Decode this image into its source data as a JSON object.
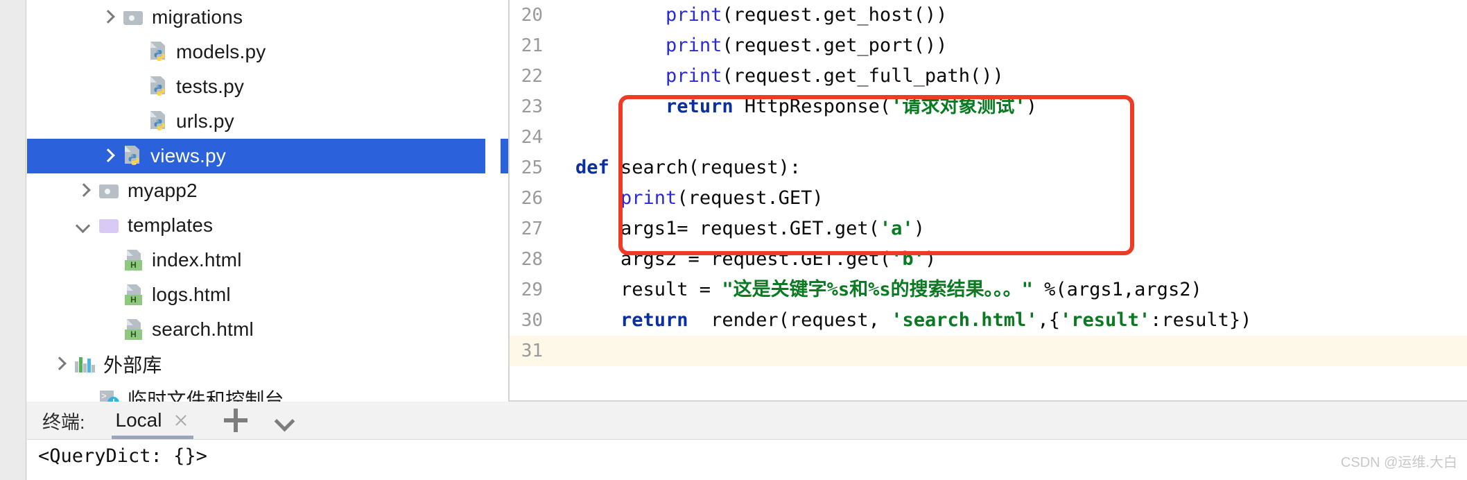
{
  "sidebar": {
    "tree": [
      {
        "label": "migrations",
        "icon": "folder-icon",
        "indent": 103,
        "chevron": "right",
        "type": "folder",
        "selected": false
      },
      {
        "label": "models.py",
        "icon": "python-file-icon",
        "indent": 140,
        "chevron": "none",
        "type": "file",
        "selected": false
      },
      {
        "label": "tests.py",
        "icon": "python-file-icon",
        "indent": 140,
        "chevron": "none",
        "type": "file",
        "selected": false
      },
      {
        "label": "urls.py",
        "icon": "python-file-icon",
        "indent": 140,
        "chevron": "none",
        "type": "file",
        "selected": false
      },
      {
        "label": "views.py",
        "icon": "python-file-icon",
        "indent": 103,
        "chevron": "right",
        "type": "file",
        "selected": true
      },
      {
        "label": "myapp2",
        "icon": "folder-icon",
        "indent": 68,
        "chevron": "right",
        "type": "folder",
        "selected": false
      },
      {
        "label": "templates",
        "icon": "folder-purple-icon",
        "indent": 68,
        "chevron": "down",
        "type": "folder",
        "selected": false
      },
      {
        "label": "index.html",
        "icon": "html-file-icon",
        "indent": 105,
        "chevron": "none",
        "type": "file",
        "selected": false
      },
      {
        "label": "logs.html",
        "icon": "html-file-icon",
        "indent": 105,
        "chevron": "none",
        "type": "file",
        "selected": false
      },
      {
        "label": "search.html",
        "icon": "html-file-icon",
        "indent": 105,
        "chevron": "none",
        "type": "file",
        "selected": false
      },
      {
        "label": "外部库",
        "icon": "bars-icon",
        "indent": 33,
        "chevron": "right",
        "type": "library",
        "selected": false
      },
      {
        "label": "临时文件和控制台",
        "icon": "scratch-console-icon",
        "indent": 68,
        "chevron": "none",
        "type": "scratch",
        "selected": false
      }
    ]
  },
  "editor": {
    "lines": [
      {
        "num": "20",
        "current": false,
        "tokens": [
          {
            "t": "        ",
            "c": "plain"
          },
          {
            "t": "print",
            "c": "fn"
          },
          {
            "t": "(request.get_host())",
            "c": "plain"
          }
        ]
      },
      {
        "num": "21",
        "current": false,
        "tokens": [
          {
            "t": "        ",
            "c": "plain"
          },
          {
            "t": "print",
            "c": "fn"
          },
          {
            "t": "(request.get_port())",
            "c": "plain"
          }
        ]
      },
      {
        "num": "22",
        "current": false,
        "tokens": [
          {
            "t": "        ",
            "c": "plain"
          },
          {
            "t": "print",
            "c": "fn"
          },
          {
            "t": "(request.get_full_path())",
            "c": "plain"
          }
        ]
      },
      {
        "num": "23",
        "current": false,
        "tokens": [
          {
            "t": "        ",
            "c": "plain"
          },
          {
            "t": "return",
            "c": "kw"
          },
          {
            "t": " HttpResponse(",
            "c": "plain"
          },
          {
            "t": "'请求对象测试'",
            "c": "str"
          },
          {
            "t": ")",
            "c": "plain"
          }
        ]
      },
      {
        "num": "24",
        "current": false,
        "tokens": []
      },
      {
        "num": "25",
        "current": false,
        "tokens": [
          {
            "t": "def",
            "c": "kw"
          },
          {
            "t": " search(request):",
            "c": "plain"
          }
        ]
      },
      {
        "num": "26",
        "current": false,
        "tokens": [
          {
            "t": "    ",
            "c": "plain"
          },
          {
            "t": "print",
            "c": "fn"
          },
          {
            "t": "(request.GET)",
            "c": "plain"
          }
        ]
      },
      {
        "num": "27",
        "current": false,
        "tokens": [
          {
            "t": "    args1= request.GET.get(",
            "c": "plain"
          },
          {
            "t": "'a'",
            "c": "str"
          },
          {
            "t": ")",
            "c": "plain"
          }
        ]
      },
      {
        "num": "28",
        "current": false,
        "tokens": [
          {
            "t": "    args2 = request.GET.get(",
            "c": "plain"
          },
          {
            "t": "'b'",
            "c": "str"
          },
          {
            "t": ")",
            "c": "plain"
          }
        ]
      },
      {
        "num": "29",
        "current": false,
        "tokens": [
          {
            "t": "    result = ",
            "c": "plain"
          },
          {
            "t": "\"这是关键字%s和%s的搜索结果。。。\"",
            "c": "str"
          },
          {
            "t": " %(args1,args2)",
            "c": "plain"
          }
        ]
      },
      {
        "num": "30",
        "current": false,
        "tokens": [
          {
            "t": "    ",
            "c": "plain"
          },
          {
            "t": "return",
            "c": "kw"
          },
          {
            "t": "  render(request, ",
            "c": "plain"
          },
          {
            "t": "'search.html'",
            "c": "str"
          },
          {
            "t": ",{",
            "c": "plain"
          },
          {
            "t": "'result'",
            "c": "str"
          },
          {
            "t": ":result})",
            "c": "plain"
          }
        ]
      },
      {
        "num": "31",
        "current": true,
        "tokens": []
      }
    ],
    "annotation": {
      "shape": "rounded-rectangle",
      "color": "#ef3b23"
    },
    "colors": {
      "keyword": "#0b2fa0",
      "function": "#2b2bd4",
      "string": "#0a7a22",
      "text": "#0a0a0a",
      "gutter": "#9a9a9a",
      "current_line_bg": "#fdf8e8",
      "selection": "#2b62dc"
    }
  },
  "terminal": {
    "title": "终端:",
    "tab_label": "Local",
    "close_icon": "close-icon",
    "add_icon": "plus-icon",
    "menu_icon": "chevron-down-icon",
    "output": "<QueryDict: {}>"
  },
  "watermark": "CSDN @运维.大白"
}
